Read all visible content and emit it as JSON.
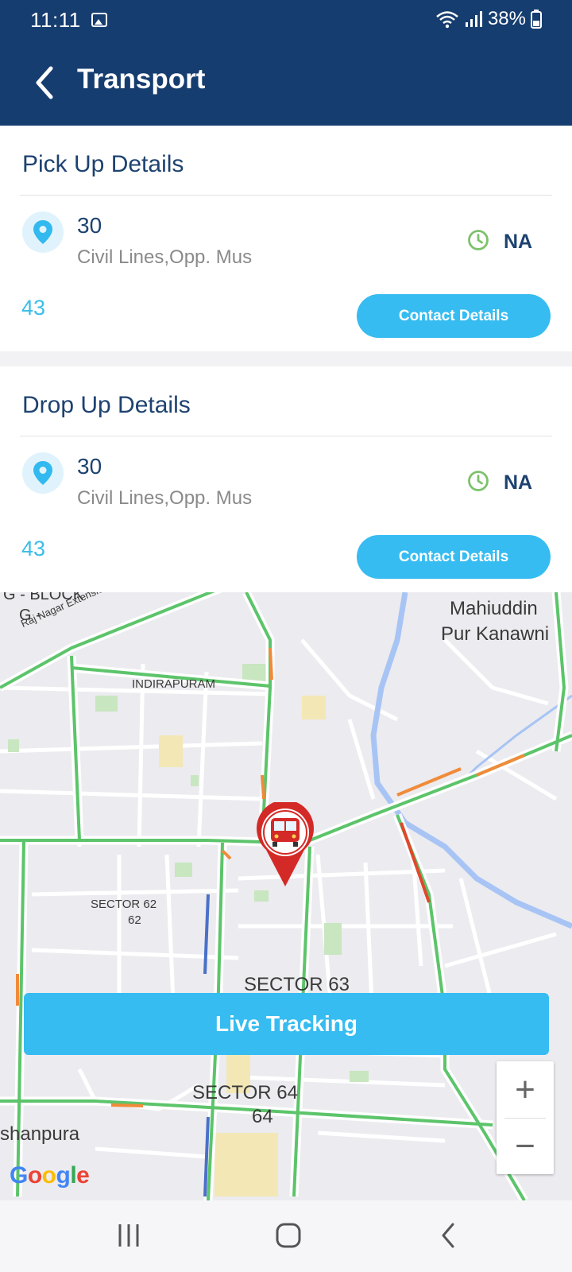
{
  "status_bar": {
    "time": "11:11",
    "battery": "38%"
  },
  "header": {
    "title": "Transport"
  },
  "pickup": {
    "heading": "Pick Up Details",
    "number": "30",
    "address": "Civil Lines,Opp. Mus",
    "time": "NA",
    "count": "43",
    "contact_label": "Contact Details"
  },
  "drop": {
    "heading": "Drop Up Details",
    "number": "30",
    "address": "Civil Lines,Opp. Mus",
    "time": "NA",
    "count": "43",
    "contact_label": "Contact Details"
  },
  "map": {
    "labels": {
      "g_block": "G - BLOCK",
      "g_dash": "G -",
      "raj_nagar": "Raj Nagar Extension Elevated Rd",
      "indirapuram": "INDIRAPURAM",
      "mahiuddin_1": "Mahiuddin",
      "mahiuddin_2": "Pur Kanawni",
      "sector62_a": "SECTOR 62",
      "sector62_b": "62",
      "sector63": "SECTOR 63",
      "sector64_a": "SECTOR 64",
      "sector64_b": "64",
      "shanpura": "shanpura"
    },
    "live_tracking_label": "Live Tracking",
    "zoom_in": "+",
    "zoom_out": "−",
    "attribution": "Google"
  },
  "colors": {
    "primary": "#163d6f",
    "accent": "#36bcf1",
    "heading_text": "#1d4270",
    "clock_green": "#7dc26b",
    "traffic_green": "#5cc46a",
    "traffic_red": "#e0482c"
  },
  "icons": [
    "back-arrow-icon",
    "location-pin-icon",
    "clock-icon",
    "bus-marker-icon",
    "wifi-icon",
    "signal-icon",
    "battery-icon",
    "gallery-icon",
    "recent-apps-icon",
    "home-icon",
    "nav-back-icon"
  ]
}
